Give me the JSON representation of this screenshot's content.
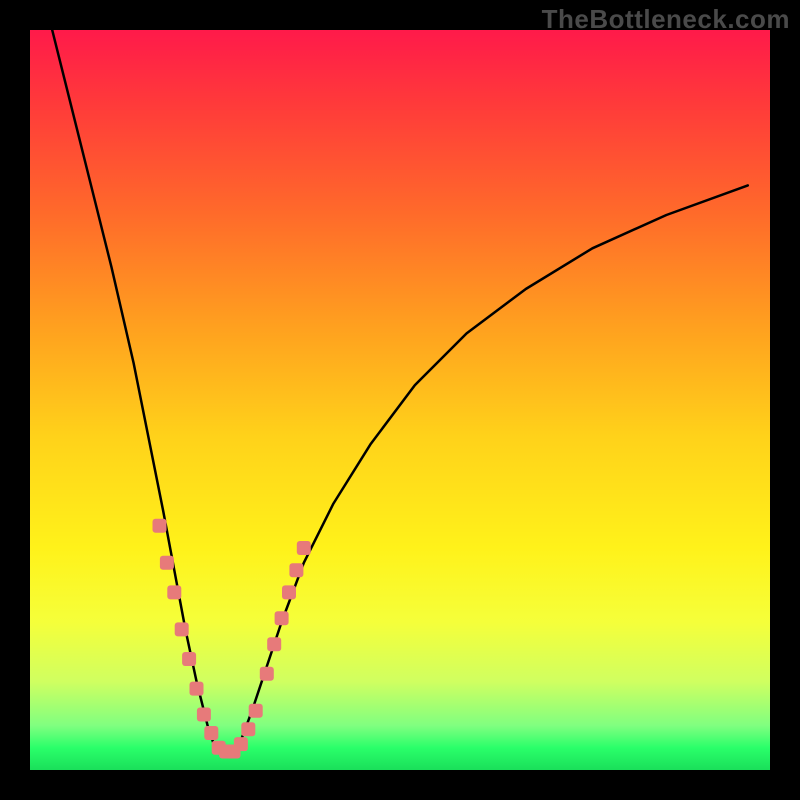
{
  "watermark": "TheBottleneck.com",
  "chart_data": {
    "type": "line",
    "title": "",
    "xlabel": "",
    "ylabel": "",
    "xlim": [
      0,
      100
    ],
    "ylim": [
      0,
      100
    ],
    "grid": false,
    "legend": false,
    "background_gradient": {
      "top_color": "#ff1a4a",
      "bottom_color": "#1adf5a",
      "description": "vertical red-to-green heat gradient"
    },
    "curve": {
      "description": "V-shaped bottleneck curve, minimum near x≈25",
      "stroke": "#000000",
      "points": [
        {
          "x": 3.0,
          "y": 100.0
        },
        {
          "x": 5.0,
          "y": 92.0
        },
        {
          "x": 8.0,
          "y": 80.0
        },
        {
          "x": 11.0,
          "y": 68.0
        },
        {
          "x": 14.0,
          "y": 55.0
        },
        {
          "x": 16.0,
          "y": 45.0
        },
        {
          "x": 18.0,
          "y": 35.0
        },
        {
          "x": 19.5,
          "y": 27.0
        },
        {
          "x": 21.0,
          "y": 19.0
        },
        {
          "x": 22.5,
          "y": 12.0
        },
        {
          "x": 24.0,
          "y": 6.0
        },
        {
          "x": 25.0,
          "y": 3.0
        },
        {
          "x": 26.0,
          "y": 2.0
        },
        {
          "x": 27.0,
          "y": 2.0
        },
        {
          "x": 28.5,
          "y": 4.0
        },
        {
          "x": 30.0,
          "y": 8.0
        },
        {
          "x": 32.0,
          "y": 14.0
        },
        {
          "x": 34.0,
          "y": 20.0
        },
        {
          "x": 37.0,
          "y": 28.0
        },
        {
          "x": 41.0,
          "y": 36.0
        },
        {
          "x": 46.0,
          "y": 44.0
        },
        {
          "x": 52.0,
          "y": 52.0
        },
        {
          "x": 59.0,
          "y": 59.0
        },
        {
          "x": 67.0,
          "y": 65.0
        },
        {
          "x": 76.0,
          "y": 70.5
        },
        {
          "x": 86.0,
          "y": 75.0
        },
        {
          "x": 97.0,
          "y": 79.0
        }
      ]
    },
    "markers": {
      "description": "salmon square markers clustered around the valley",
      "fill": "#e77a7a",
      "size": 14,
      "points": [
        {
          "x": 17.5,
          "y": 33.0
        },
        {
          "x": 18.5,
          "y": 28.0
        },
        {
          "x": 19.5,
          "y": 24.0
        },
        {
          "x": 20.5,
          "y": 19.0
        },
        {
          "x": 21.5,
          "y": 15.0
        },
        {
          "x": 22.5,
          "y": 11.0
        },
        {
          "x": 23.5,
          "y": 7.5
        },
        {
          "x": 24.5,
          "y": 5.0
        },
        {
          "x": 25.5,
          "y": 3.0
        },
        {
          "x": 26.5,
          "y": 2.5
        },
        {
          "x": 27.5,
          "y": 2.5
        },
        {
          "x": 28.5,
          "y": 3.5
        },
        {
          "x": 29.5,
          "y": 5.5
        },
        {
          "x": 30.5,
          "y": 8.0
        },
        {
          "x": 32.0,
          "y": 13.0
        },
        {
          "x": 33.0,
          "y": 17.0
        },
        {
          "x": 34.0,
          "y": 20.5
        },
        {
          "x": 35.0,
          "y": 24.0
        },
        {
          "x": 36.0,
          "y": 27.0
        },
        {
          "x": 37.0,
          "y": 30.0
        }
      ]
    }
  }
}
